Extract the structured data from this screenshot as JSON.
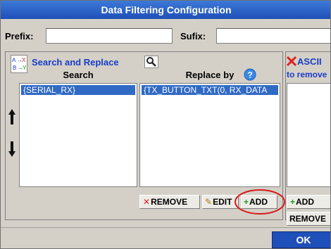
{
  "window": {
    "title": "Data Filtering Configuration"
  },
  "prefix": {
    "label": "Prefix:",
    "value": ""
  },
  "suffix": {
    "label": "Sufix:",
    "value": ""
  },
  "search_replace": {
    "title": "Search and Replace",
    "columns": {
      "search": "Search",
      "replace": "Replace by"
    },
    "search_items": [
      "{SERIAL_RX}"
    ],
    "replace_items": [
      "{TX_BUTTON_TXT(0, RX_DATA"
    ],
    "buttons": {
      "remove": "REMOVE",
      "edit": "EDIT",
      "add": "ADD"
    }
  },
  "ascii": {
    "title": "ASCII",
    "subtitle": "to remove",
    "buttons": {
      "add": "ADD",
      "remove": "REMOVE"
    }
  },
  "ok_label": "OK",
  "colors": {
    "accent": "#1a3cc8",
    "selection": "#316ac5",
    "remove_red": "#e02020",
    "add_green": "#1a9a1a",
    "highlight_ring": "#d81818"
  }
}
